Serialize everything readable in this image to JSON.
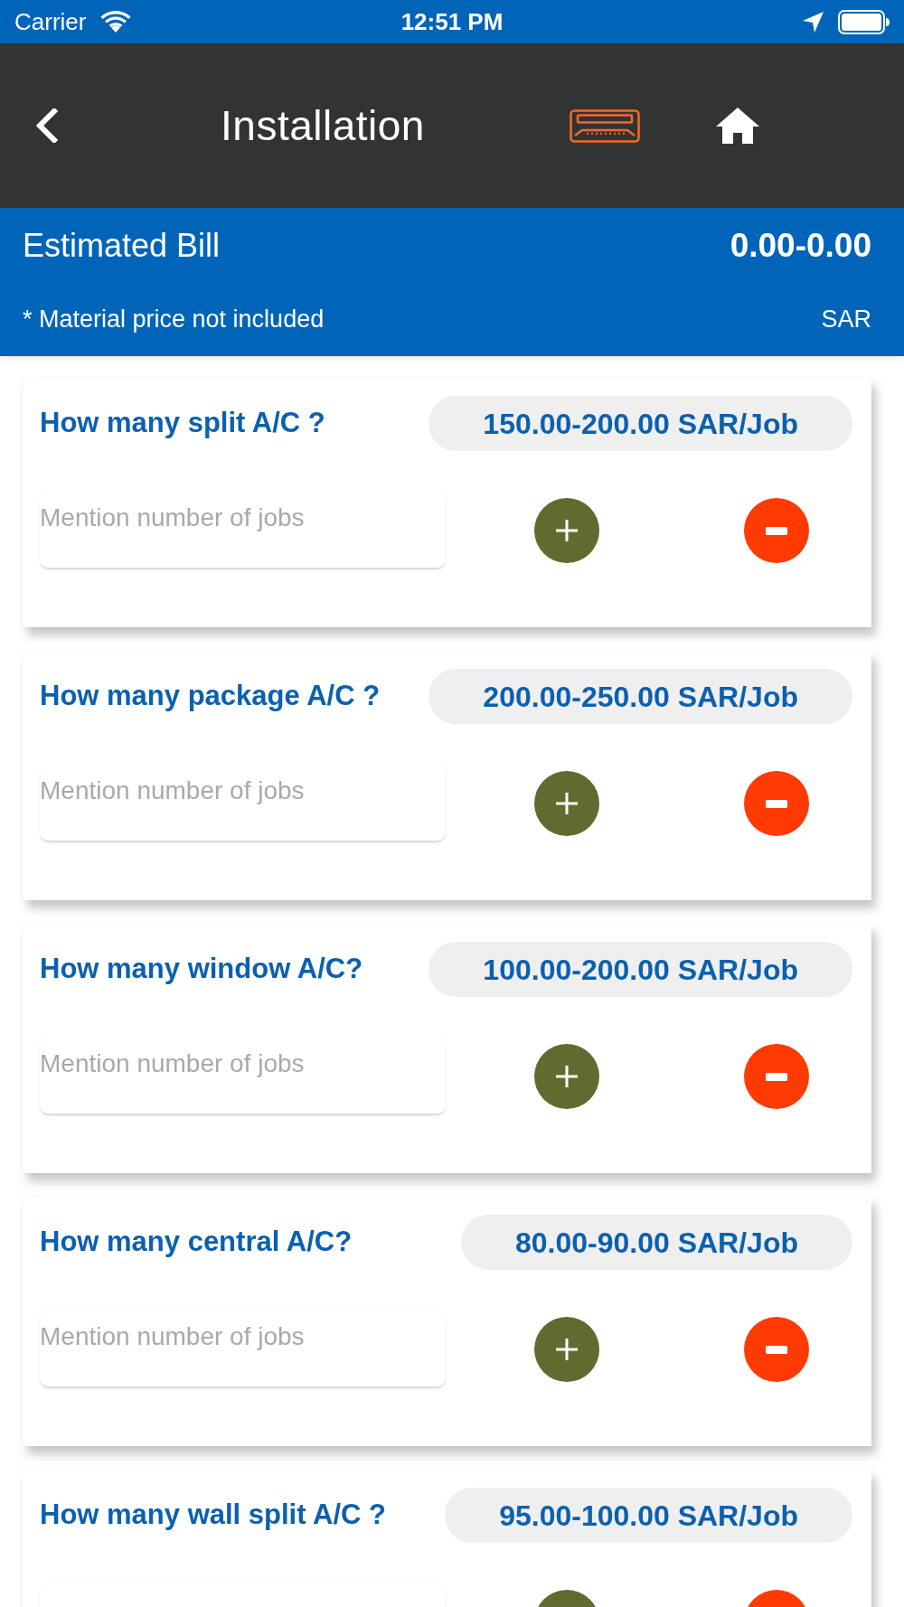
{
  "status_bar": {
    "carrier": "Carrier",
    "time": "12:51 PM"
  },
  "header": {
    "title": "Installation"
  },
  "estimate": {
    "label": "Estimated Bill",
    "amount": "0.00-0.00",
    "note": "* Material price not included",
    "currency": "SAR"
  },
  "services": [
    {
      "question": "How many split A/C ?",
      "price": "150.00-200.00 SAR/Job",
      "placeholder": "Mention number of jobs"
    },
    {
      "question": "How many package A/C ?",
      "price": "200.00-250.00 SAR/Job",
      "placeholder": "Mention number of jobs"
    },
    {
      "question": "How many window A/C?",
      "price": "100.00-200.00 SAR/Job",
      "placeholder": "Mention number of jobs"
    },
    {
      "question": "How many central A/C?",
      "price": "80.00-90.00 SAR/Job",
      "placeholder": "Mention number of jobs"
    },
    {
      "question": "How many wall split A/C ?",
      "price": "95.00-100.00 SAR/Job"
    }
  ]
}
